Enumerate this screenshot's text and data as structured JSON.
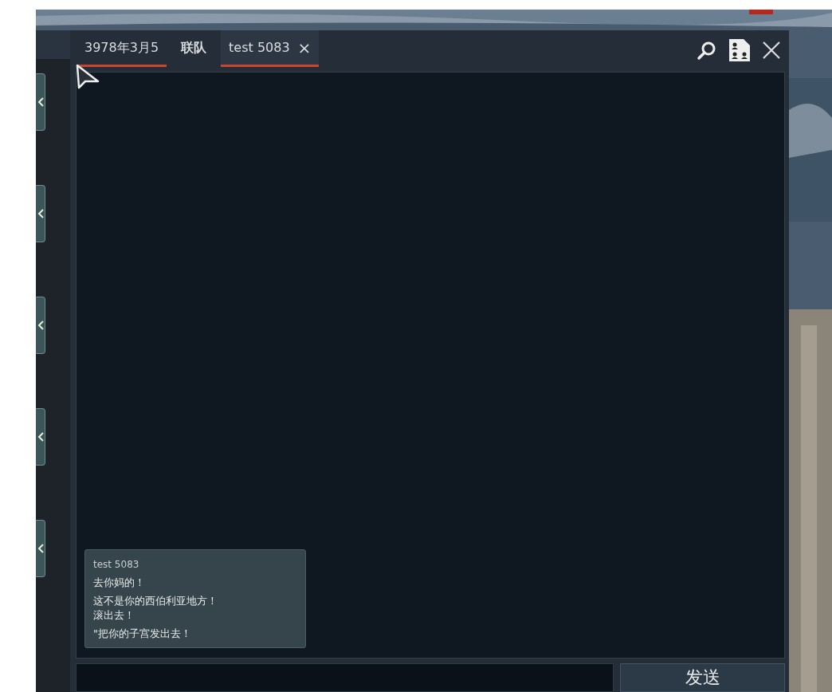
{
  "tabs": [
    {
      "label": "3978年3月5",
      "selected": false,
      "highlighted": true,
      "closable": false
    },
    {
      "label": "联队",
      "selected": false,
      "highlighted": false,
      "closable": false
    },
    {
      "label": "test 5083",
      "selected": true,
      "highlighted": true,
      "closable": true
    }
  ],
  "close_tab_glyph": "×",
  "messages": [
    {
      "sender": "test 5083",
      "paragraphs": [
        [
          "去你妈的！"
        ],
        [
          "这不是你的西伯利亚地方！",
          "滚出去！"
        ],
        [
          "\"把你的子宫发出去！"
        ]
      ]
    }
  ],
  "send_button": "发送"
}
